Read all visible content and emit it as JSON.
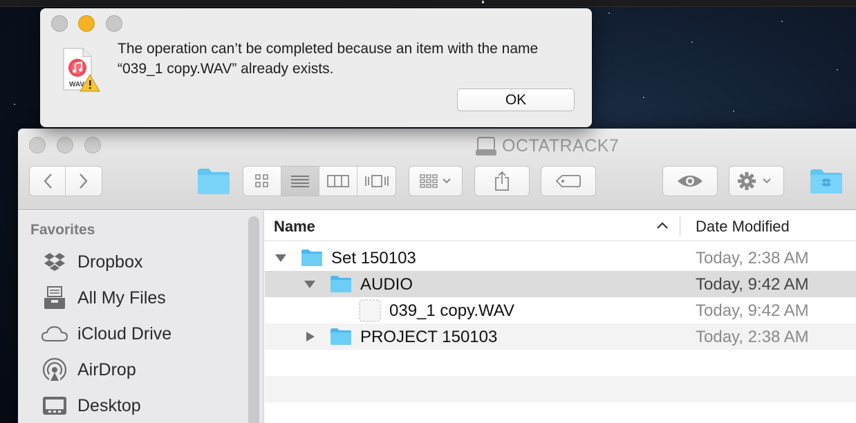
{
  "alert": {
    "message": "The operation can’t be completed because an item with the name “039_1 copy.WAV” already exists.",
    "ok_label": "OK",
    "file_icon_label": "WAV",
    "icon": "wav-file-warning-icon"
  },
  "window": {
    "title": "OCTATRACK7",
    "title_icon": "hard-disk-icon"
  },
  "toolbar": {
    "back_icon": "chevron-left-icon",
    "forward_icon": "chevron-right-icon",
    "view_modes": [
      "icon-view-icon",
      "list-view-icon",
      "column-view-icon",
      "cover-flow-icon"
    ],
    "active_view": "list-view-icon",
    "arrange_icon": "arrange-icon",
    "share_icon": "share-icon",
    "tag_icon": "tag-icon",
    "quicklook_icon": "eye-icon",
    "action_icon": "gear-icon",
    "dropbox_icon": "dropbox-folder-icon"
  },
  "sidebar": {
    "section_title": "Favorites",
    "items": [
      {
        "label": "Dropbox",
        "icon": "dropbox-icon"
      },
      {
        "label": "All My Files",
        "icon": "all-my-files-icon"
      },
      {
        "label": "iCloud Drive",
        "icon": "cloud-icon"
      },
      {
        "label": "AirDrop",
        "icon": "airdrop-icon"
      },
      {
        "label": "Desktop",
        "icon": "desktop-icon"
      }
    ]
  },
  "list": {
    "col_name": "Name",
    "col_date": "Date Modified",
    "rows": [
      {
        "name": "Set 150103",
        "date": "Today, 2:38 AM",
        "expanded": true,
        "kind": "folder"
      },
      {
        "name": "AUDIO",
        "date": "Today, 9:42 AM",
        "expanded": true,
        "kind": "folder",
        "selected": true
      },
      {
        "name": "039_1 copy.WAV",
        "date": "Today, 9:42 AM",
        "kind": "file"
      },
      {
        "name": "PROJECT 150103",
        "date": "Today, 2:38 AM",
        "expanded": false,
        "kind": "folder"
      }
    ]
  },
  "colors": {
    "folder_blue": "#5fc6f3",
    "selection_gray": "#dcdcdc",
    "close_dot": "#c8c8c8",
    "minimize_dot": "#f5b324"
  }
}
